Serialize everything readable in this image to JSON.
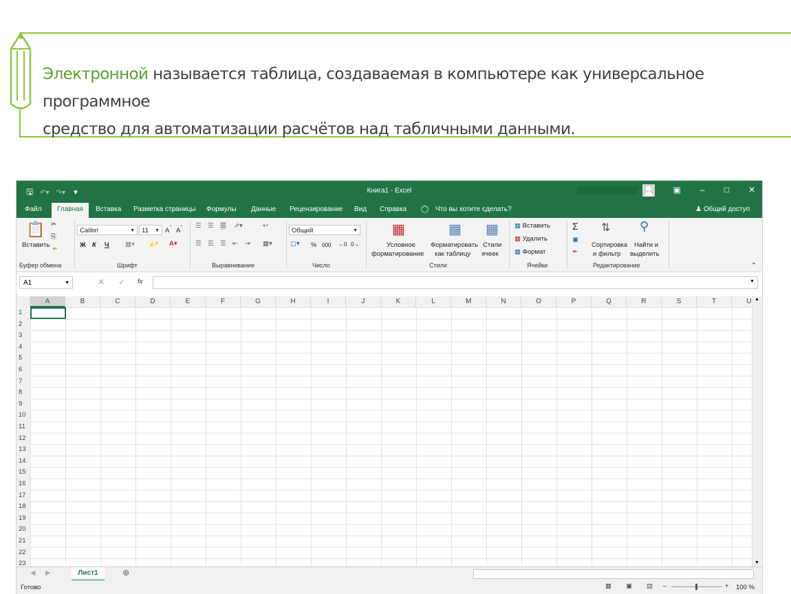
{
  "slide": {
    "highlight": "Электронной",
    "text_line1": " называется таблица, создаваемая в компьютере как универсальное программное",
    "text_line2": "средство для автоматизации расчётов над табличными данными."
  },
  "window": {
    "title": "Книга1  -  Excel",
    "accent": "#217346"
  },
  "tabs": [
    "Файл",
    "Главная",
    "Вставка",
    "Разметка страницы",
    "Формулы",
    "Данные",
    "Рецензирование",
    "Вид",
    "Справка"
  ],
  "tell_me": "Что вы хотите сделать?",
  "share": "Общий доступ",
  "ribbon": {
    "clipboard": {
      "paste": "Вставить",
      "label": "Буфер обмена"
    },
    "font": {
      "name": "Calibri",
      "size": "11",
      "bold": "Ж",
      "italic": "К",
      "underline": "Ч",
      "label": "Шрифт"
    },
    "alignment": {
      "label": "Выравнивание"
    },
    "number": {
      "format": "Общий",
      "label": "Число"
    },
    "styles": {
      "conditional1": "Условное",
      "conditional2": "форматирование",
      "astable1": "Форматировать",
      "astable2": "как таблицу",
      "cell1": "Стили",
      "cell2": "ячеек",
      "label": "Стили"
    },
    "cells": {
      "insert": "Вставить",
      "delete": "Удалить",
      "format": "Формат",
      "label": "Ячейки"
    },
    "editing": {
      "sort1": "Сортировка",
      "sort2": "и фильтр",
      "find1": "Найти и",
      "find2": "выделить",
      "label": "Редактирование"
    }
  },
  "formula_bar": {
    "name_box": "A1",
    "fx": "fx"
  },
  "columns": [
    "A",
    "B",
    "C",
    "D",
    "E",
    "F",
    "G",
    "H",
    "I",
    "J",
    "K",
    "L",
    "M",
    "N",
    "O",
    "P",
    "Q",
    "R",
    "S",
    "T",
    "U"
  ],
  "rows": [
    "1",
    "2",
    "3",
    "4",
    "5",
    "6",
    "7",
    "8",
    "9",
    "10",
    "11",
    "12",
    "13",
    "14",
    "15",
    "16",
    "17",
    "18",
    "19",
    "20",
    "21",
    "22",
    "23"
  ],
  "sheet": {
    "tab": "Лист1"
  },
  "status": {
    "ready": "Готово",
    "zoom": "100 %"
  }
}
